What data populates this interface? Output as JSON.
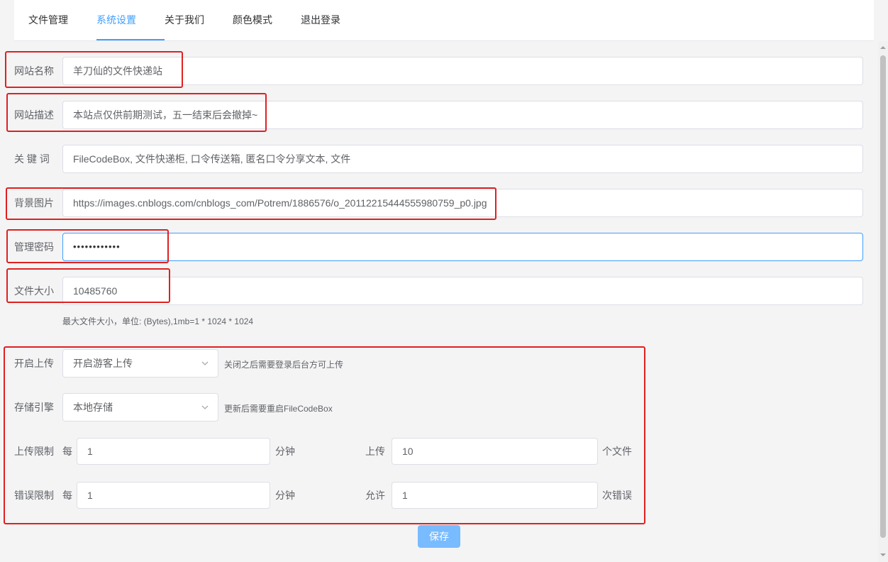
{
  "tabs": [
    {
      "label": "文件管理",
      "active": false
    },
    {
      "label": "系统设置",
      "active": true
    },
    {
      "label": "关于我们",
      "active": false
    },
    {
      "label": "颜色模式",
      "active": false
    },
    {
      "label": "退出登录",
      "active": false
    }
  ],
  "form": {
    "site_name": {
      "label": "网站名称",
      "value": "羊刀仙的文件快递站"
    },
    "site_desc": {
      "label": "网站描述",
      "value": "本站点仅供前期测试，五一结束后会撤掉~"
    },
    "keywords": {
      "label": "关 键 词",
      "value": "FileCodeBox, 文件快递柜, 口令传送箱, 匿名口令分享文本, 文件"
    },
    "background": {
      "label": "背景图片",
      "value": "https://images.cnblogs.com/cnblogs_com/Potrem/1886576/o_20112215444555980759_p0.jpg"
    },
    "admin_password": {
      "label": "管理密码",
      "value": "••••••••••••"
    },
    "file_size": {
      "label": "文件大小",
      "value": "10485760",
      "hint": "最大文件大小，单位: (Bytes),1mb=1 * 1024 * 1024"
    },
    "enable_upload": {
      "label": "开启上传",
      "selected": "开启游客上传",
      "hint": "关闭之后需要登录后台方可上传"
    },
    "storage_engine": {
      "label": "存储引擎",
      "selected": "本地存储",
      "hint": "更新后需要重启FileCodeBox"
    },
    "upload_limit": {
      "label": "上传限制",
      "prefix": "每",
      "minutes": "1",
      "unit_minutes": "分钟",
      "mid": "上传",
      "count": "10",
      "unit_count": "个文件"
    },
    "error_limit": {
      "label": "错误限制",
      "prefix": "每",
      "minutes": "1",
      "unit_minutes": "分钟",
      "mid": "允许",
      "count": "1",
      "unit_count": "次错误"
    }
  },
  "save_label": "保存",
  "colors": {
    "accent": "#409eff",
    "annotation": "#e02020",
    "save_button": "#79bbff"
  },
  "icons": [
    "chevron-down-icon",
    "scroll-up-icon",
    "scroll-down-icon"
  ]
}
